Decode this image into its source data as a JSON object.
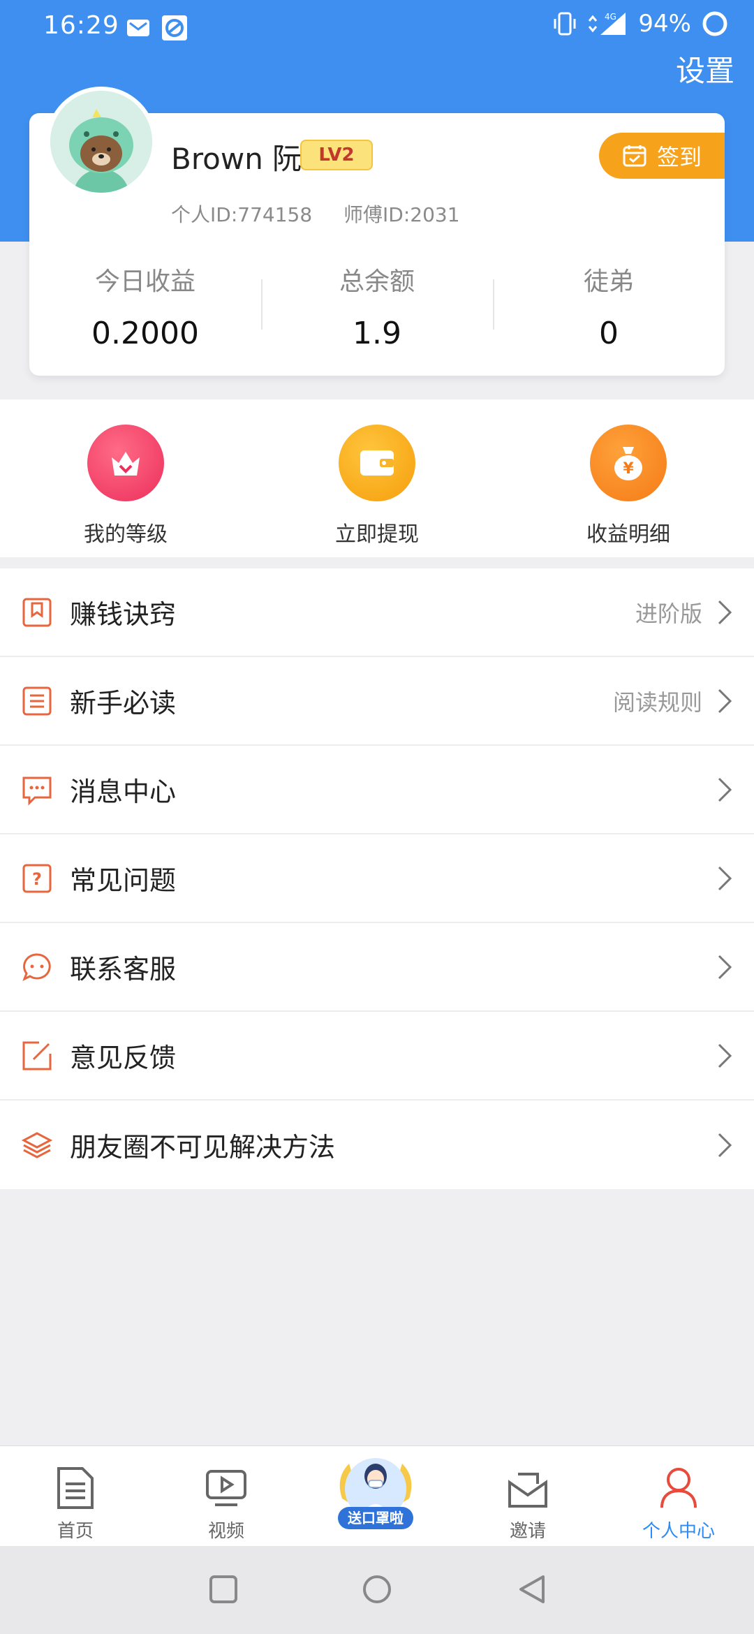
{
  "status_bar": {
    "time": "16:29",
    "battery": "94%",
    "network": "4G"
  },
  "header": {
    "settings_label": "设置"
  },
  "profile": {
    "name": "Brown 阮",
    "level": "LV2",
    "personal_id": "个人ID:774158",
    "master_id": "师傅ID:2031",
    "signin_label": "签到"
  },
  "stats": [
    {
      "label": "今日收益",
      "value": "0.2000"
    },
    {
      "label": "总余额",
      "value": "1.9"
    },
    {
      "label": "徒弟",
      "value": "0"
    }
  ],
  "quick_actions": [
    {
      "label": "我的等级",
      "icon": "crown-icon",
      "color": "#f0456a"
    },
    {
      "label": "立即提现",
      "icon": "wallet-icon",
      "color": "#f8a51d"
    },
    {
      "label": "收益明细",
      "icon": "money-bag-icon",
      "color": "#f57d1f"
    }
  ],
  "menu": [
    {
      "label": "赚钱诀窍",
      "hint": "进阶版",
      "icon": "bookmark-icon"
    },
    {
      "label": "新手必读",
      "hint": "阅读规则",
      "icon": "document-list-icon"
    },
    {
      "label": "消息中心",
      "hint": "",
      "icon": "message-icon"
    },
    {
      "label": "常见问题",
      "hint": "",
      "icon": "question-icon"
    },
    {
      "label": "联系客服",
      "hint": "",
      "icon": "chat-bubble-icon"
    },
    {
      "label": "意见反馈",
      "hint": "",
      "icon": "edit-icon"
    },
    {
      "label": "朋友圈不可见解决方法",
      "hint": "",
      "icon": "layers-icon"
    }
  ],
  "tabbar": [
    {
      "label": "首页",
      "icon": "document-icon",
      "active": false
    },
    {
      "label": "视频",
      "icon": "video-icon",
      "active": false
    },
    {
      "label": "送口罩啦",
      "icon": "promo-icon",
      "active": false
    },
    {
      "label": "邀请",
      "icon": "envelope-icon",
      "active": false
    },
    {
      "label": "个人中心",
      "icon": "person-icon",
      "active": true
    }
  ],
  "colors": {
    "header_blue": "#3f8ff0",
    "accent_orange": "#f7a21b",
    "menu_icon": "#e8663d",
    "active_tab": "#2b8cf5"
  }
}
